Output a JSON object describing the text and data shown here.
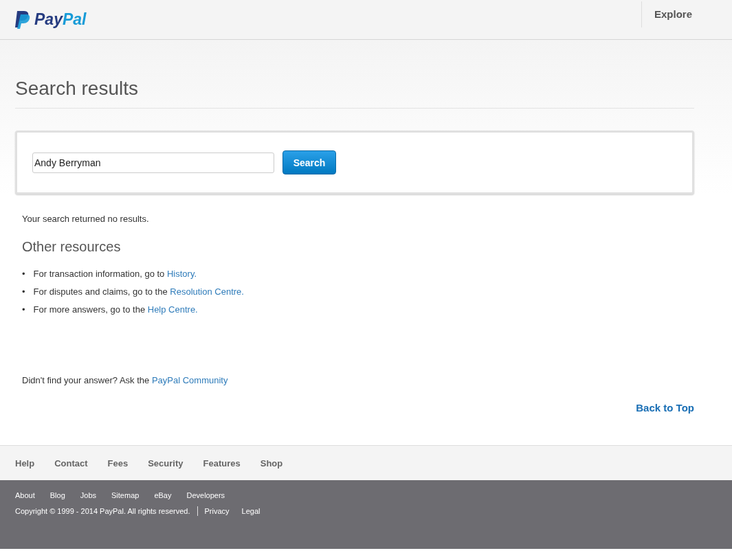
{
  "header": {
    "logo": {
      "first": "Pay",
      "second": "Pal"
    },
    "nav": [
      "Explore"
    ]
  },
  "title": "Search results",
  "search": {
    "value": "Andy Berryman",
    "button": "Search"
  },
  "message": "Your search returned no results.",
  "resources": {
    "heading": "Other resources",
    "items": [
      {
        "bullet": "•",
        "text": "For transaction information, go to ",
        "link": "History."
      },
      {
        "bullet": "•",
        "text": "For disputes and claims, go to the ",
        "link": "Resolution Centre."
      },
      {
        "bullet": "•",
        "text": "For more answers, go to the ",
        "link": "Help Centre."
      }
    ]
  },
  "community": {
    "text": "Didn't find your answer? Ask the ",
    "link": "PayPal Community"
  },
  "back_to_top": "Back to Top",
  "footer_nav": [
    "Help",
    "Contact",
    "Fees",
    "Security",
    "Features",
    "Shop"
  ],
  "footer_links": [
    "About",
    "Blog",
    "Jobs",
    "Sitemap",
    "eBay",
    "Developers"
  ],
  "copyright": "Copyright © 1999 - 2014 PayPal. All rights reserved.",
  "legal_links": [
    "Privacy",
    "Legal"
  ]
}
